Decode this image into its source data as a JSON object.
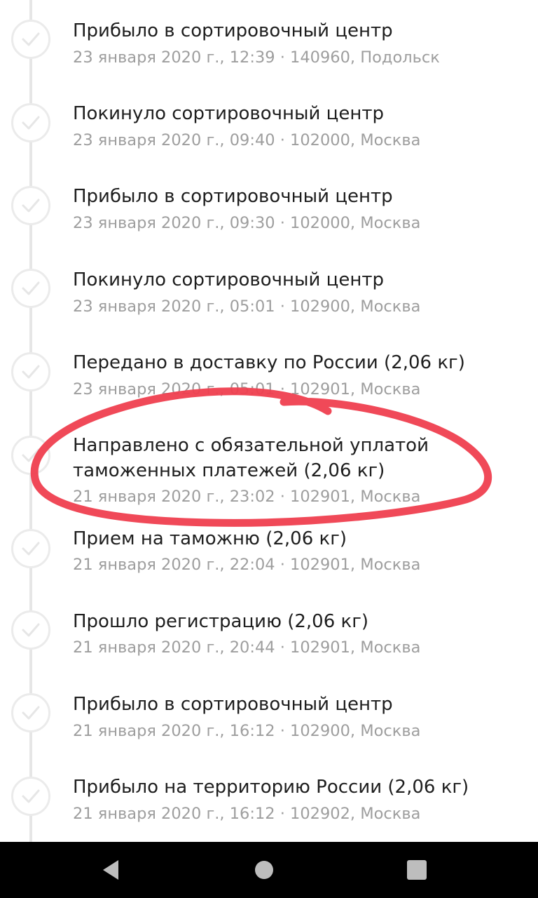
{
  "tracking": {
    "events": [
      {
        "title": "Прибыло в сортировочный центр",
        "details": "23 января 2020 г., 12:39 · 140960, Подольск"
      },
      {
        "title": "Покинуло сортировочный центр",
        "details": "23 января 2020 г., 09:40 · 102000, Москва"
      },
      {
        "title": "Прибыло в сортировочный центр",
        "details": "23 января 2020 г., 09:30 · 102000, Москва"
      },
      {
        "title": "Покинуло сортировочный центр",
        "details": "23 января 2020 г., 05:01 · 102900, Москва"
      },
      {
        "title": "Передано в доставку по России (2,06 кг)",
        "details": "23 января 2020 г., 05:01 · 102901, Москва"
      },
      {
        "title_line1": "Направлено с обязательной уплатой",
        "title_line2": "таможенных платежей (2,06 кг)",
        "details": "21 января 2020 г., 23:02 · 102901, Москва"
      },
      {
        "title": "Прием на таможню (2,06 кг)",
        "details": "21 января 2020 г., 22:04 · 102901, Москва"
      },
      {
        "title": "Прошло регистрацию (2,06 кг)",
        "details": "21 января 2020 г., 20:44 · 102901, Москва"
      },
      {
        "title": "Прибыло в сортировочный центр",
        "details": "21 января 2020 г., 16:12 · 102900, Москва"
      },
      {
        "title": "Прибыло на территорию России (2,06 кг)",
        "details": "21 января 2020 г., 16:12 · 102902, Москва"
      }
    ]
  },
  "icons": {
    "status": "check-icon",
    "nav_back": "triangle-back-icon",
    "nav_home": "circle-home-icon",
    "nav_recents": "square-recents-icon"
  },
  "colors": {
    "title": "#1e1e1e",
    "details": "#9e9e9e",
    "timeline": "#e6e6e6",
    "annotation": "#ef3f4f",
    "nav_bar": "#000000"
  }
}
